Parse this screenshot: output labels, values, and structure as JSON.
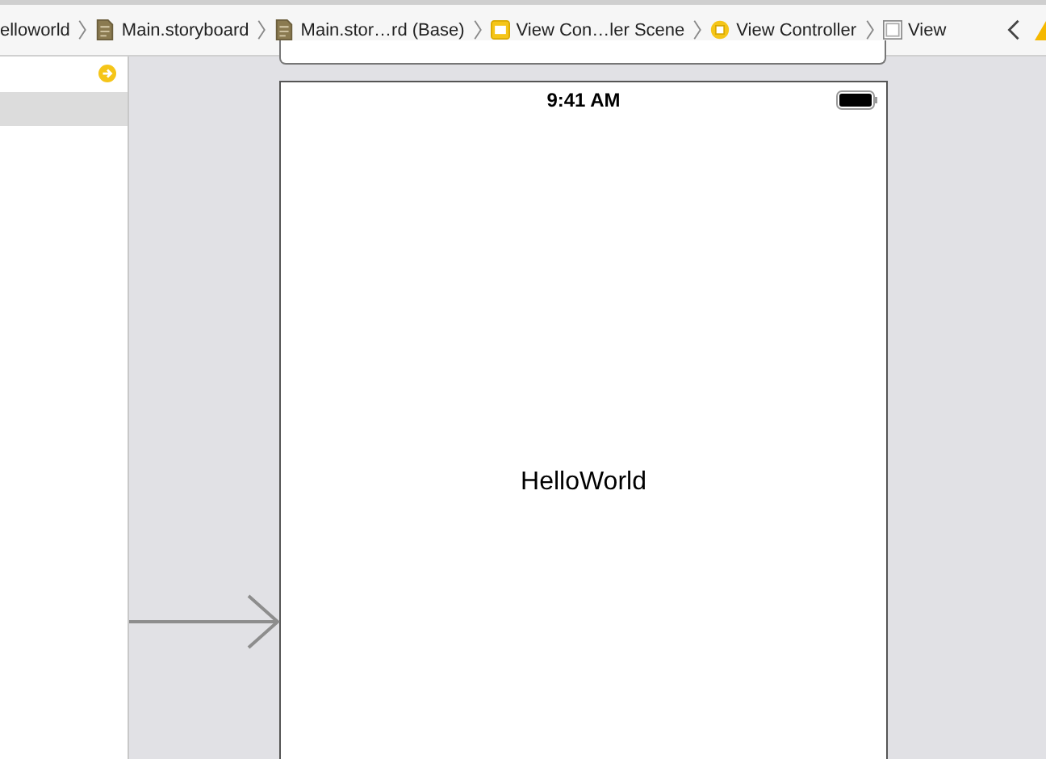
{
  "breadcrumb": {
    "items": [
      {
        "label": "elloworld",
        "kind": "none"
      },
      {
        "label": "Main.storyboard",
        "kind": "file"
      },
      {
        "label": "Main.stor…rd (Base)",
        "kind": "file"
      },
      {
        "label": "View Con…ler Scene",
        "kind": "scene"
      },
      {
        "label": "View Controller",
        "kind": "controller"
      },
      {
        "label": "View",
        "kind": "view"
      }
    ]
  },
  "outline": {
    "rows": [
      {
        "selected": false
      },
      {
        "selected": true
      }
    ]
  },
  "phone": {
    "status_time": "9:41 AM",
    "label": "HelloWorld"
  }
}
